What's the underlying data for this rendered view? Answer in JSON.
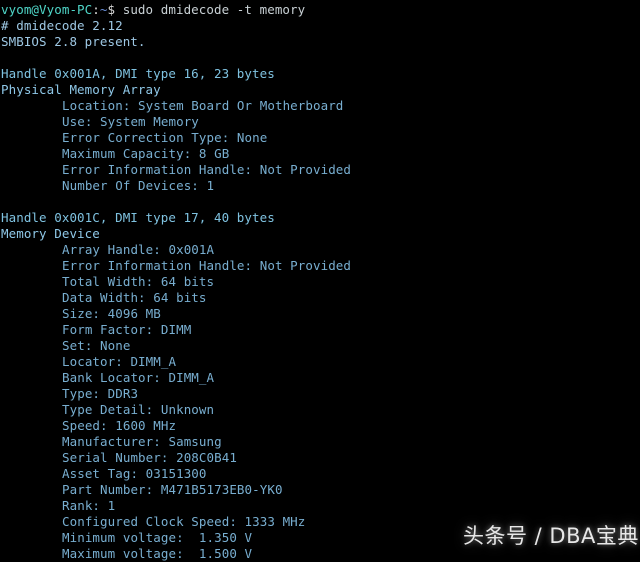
{
  "terminal": {
    "prompt": {
      "user_host": "vyom@Vyom-PC",
      "colon": ":",
      "path": "~",
      "sigil": "$ ",
      "command": "sudo dmidecode -t memory"
    },
    "header": {
      "version": "# dmidecode 2.12",
      "smbios": "SMBIOS 2.8 present."
    },
    "sections": [
      {
        "handle": "Handle 0x001A, DMI type 16, 23 bytes",
        "type_name": "Physical Memory Array",
        "fields": [
          "Location: System Board Or Motherboard",
          "Use: System Memory",
          "Error Correction Type: None",
          "Maximum Capacity: 8 GB",
          "Error Information Handle: Not Provided",
          "Number Of Devices: 1"
        ]
      },
      {
        "handle": "Handle 0x001C, DMI type 17, 40 bytes",
        "type_name": "Memory Device",
        "fields": [
          "Array Handle: 0x001A",
          "Error Information Handle: Not Provided",
          "Total Width: 64 bits",
          "Data Width: 64 bits",
          "Size: 4096 MB",
          "Form Factor: DIMM",
          "Set: None",
          "Locator: DIMM_A",
          "Bank Locator: DIMM_A",
          "Type: DDR3",
          "Type Detail: Unknown",
          "Speed: 1600 MHz",
          "Manufacturer: Samsung",
          "Serial Number: 208C0B41",
          "Asset Tag: 03151300",
          "Part Number: M471B5173EB0-YK0",
          "Rank: 1",
          "Configured Clock Speed: 1333 MHz",
          "Minimum voltage:  1.350 V",
          "Maximum voltage:  1.500 V"
        ]
      }
    ]
  },
  "watermark": {
    "text": "头条号 / DBA宝典"
  },
  "colors": {
    "background": "#000000",
    "prompt_user": "#4fd6c8",
    "prompt_path": "#6a8fd8",
    "command_text": "#c8d0d4",
    "handle_line": "#7fc2e0",
    "type_name": "#8fc8e8",
    "field_line": "#78aed0",
    "watermark": "#e8e8e8"
  }
}
